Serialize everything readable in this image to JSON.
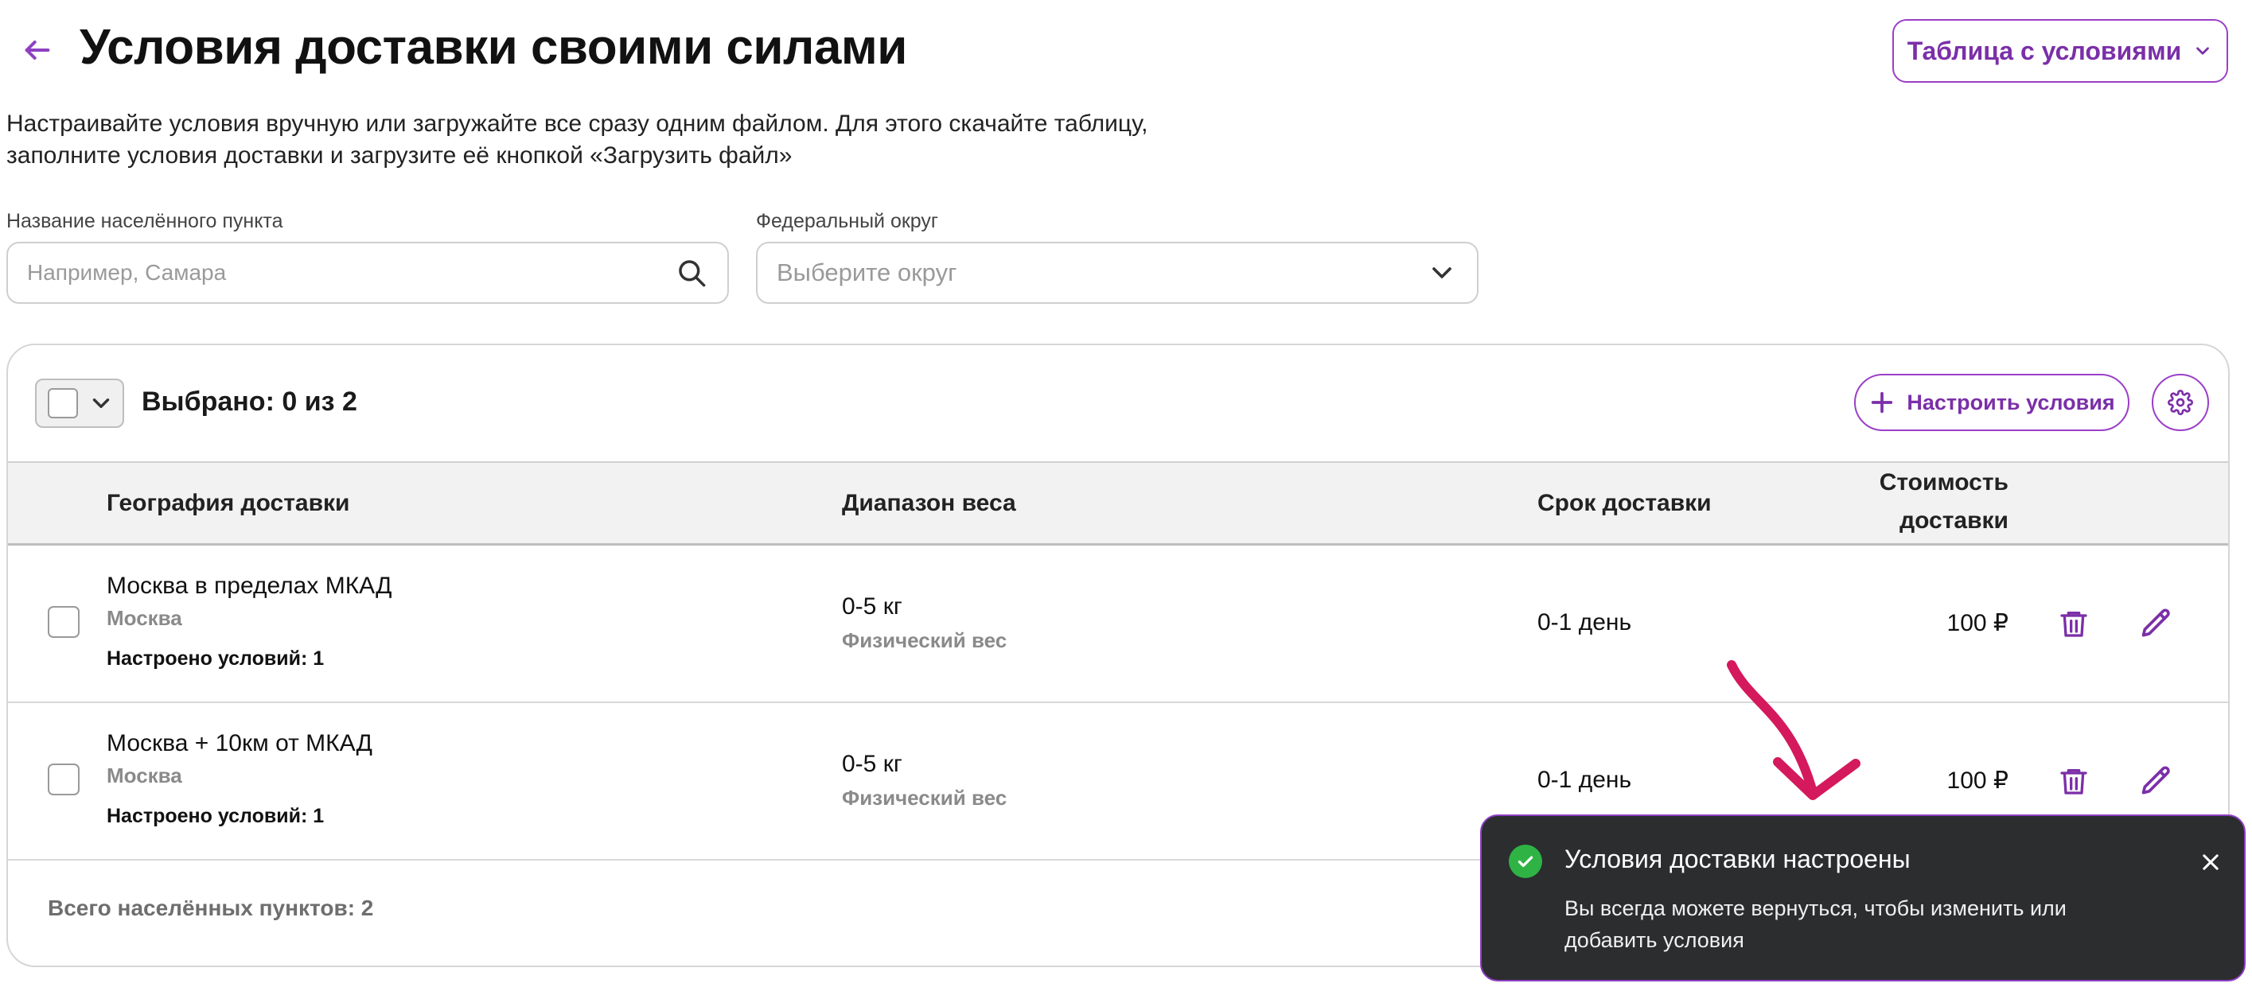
{
  "header": {
    "title": "Условия доставки своими силами",
    "table_button_label": "Таблица с условиями"
  },
  "description": "Настраивайте условия вручную или загружайте все сразу одним файлом. Для этого скачайте таблицу, заполните условия доставки и загрузите её кнопкой «Загрузить файл»",
  "filters": {
    "city_label": "Название населённого пункта",
    "city_placeholder": "Например, Самара",
    "district_label": "Федеральный округ",
    "district_placeholder": "Выберите округ"
  },
  "toolbar": {
    "selected_text": "Выбрано: 0 из 2",
    "configure_button_label": "Настроить условия"
  },
  "table": {
    "columns": {
      "geography": "География доставки",
      "weight": "Диапазон веса",
      "term": "Срок доставки",
      "cost_line1": "Стоимость",
      "cost_line2": "доставки"
    },
    "rows": [
      {
        "geo": "Москва в пределах МКАД",
        "region": "Москва",
        "conditions": "Настроено условий: 1",
        "weight": "0-5 кг",
        "weight_type": "Физический вес",
        "term": "0-1 день",
        "cost": "100 ₽"
      },
      {
        "geo": "Москва + 10км от МКАД",
        "region": "Москва",
        "conditions": "Настроено условий: 1",
        "weight": "0-5 кг",
        "weight_type": "Физический вес",
        "term": "0-1 день",
        "cost": "100 ₽"
      }
    ],
    "total": "Всего населённых пунктов: 2"
  },
  "toast": {
    "title": "Условия доставки настроены",
    "message": "Вы всегда можете вернуться, чтобы изменить или добавить условия"
  },
  "colors": {
    "accent": "#9b3fc8",
    "accent_text": "#7b2fa8",
    "toast_bg": "#2b2d2f",
    "success": "#2fb344",
    "arrow": "#d4195c"
  },
  "icons": {
    "back": "arrow-left-icon",
    "dropdown": "chevron-down-icon",
    "search": "search-icon",
    "plus": "plus-icon",
    "settings": "gear-icon",
    "delete": "trash-icon",
    "edit": "pencil-icon",
    "success": "check-circle-icon",
    "close": "close-icon"
  }
}
